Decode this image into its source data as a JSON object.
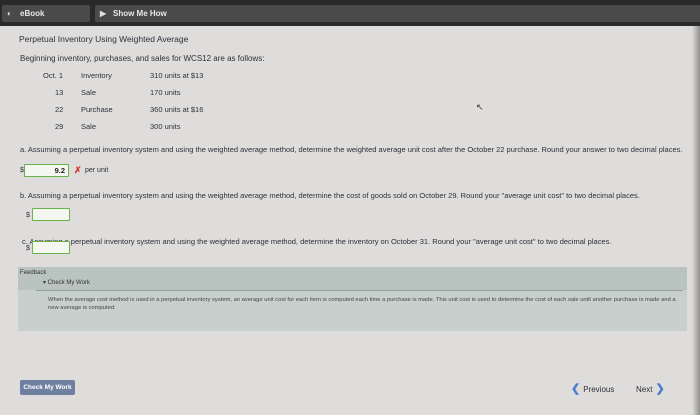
{
  "tabs": {
    "ebook": "eBook",
    "show_me": "Show Me How"
  },
  "problem": {
    "title": "Perpetual Inventory Using Weighted Average",
    "intro": "Beginning inventory, purchases, and sales for WCS12 are as follows:",
    "rows": [
      {
        "date": "Oct. 1",
        "type": "Inventory",
        "detail": "310 units at $13"
      },
      {
        "date": "13",
        "type": "Sale",
        "detail": "170 units"
      },
      {
        "date": "22",
        "type": "Purchase",
        "detail": "360 units at $16"
      },
      {
        "date": "29",
        "type": "Sale",
        "detail": "300 units"
      }
    ]
  },
  "questions": {
    "a": {
      "text": "a. Assuming a perpetual inventory system and using the weighted average method, determine the weighted average unit cost after the October 22 purchase. Round your answer to two decimal places.",
      "currency": "$",
      "answer": "9.2",
      "mark": "✗",
      "unit": "per unit"
    },
    "b": {
      "text": "b. Assuming a perpetual inventory system and using the weighted average method, determine the cost of goods sold on October 29. Round your \"average unit cost\" to two decimal places.",
      "currency": "$"
    },
    "c": {
      "text": "c. Assuming a perpetual inventory system and using the weighted average method, determine the inventory on October 31. Round your \"average unit cost\" to two decimal places.",
      "currency": "$"
    }
  },
  "feedback": {
    "label": "Feedback",
    "check": "▾ Check My Work",
    "text": "When the average cost method is used in a perpetual inventory system, an average unit cost for each item is computed each time a purchase is made. This unit cost is used to determine the cost of each sale until another purchase is made and a new average is computed."
  },
  "footer": {
    "check_button": "Check My Work",
    "previous": "Previous",
    "next": "Next"
  },
  "colors": {
    "input_border": "#69b24a",
    "error": "#d23a2a",
    "nav_accent": "#4a7dd0"
  }
}
